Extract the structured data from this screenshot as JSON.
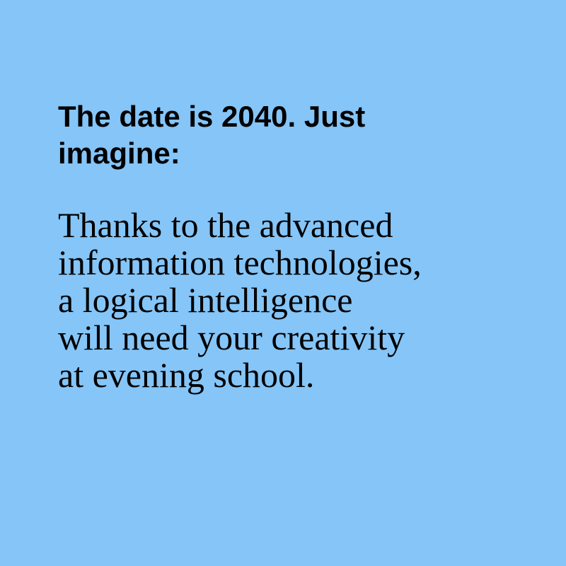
{
  "slide": {
    "background_color": "#85c5f8",
    "text_color": "#000000",
    "headline_lines": [
      "The date is 2040. Just",
      "imagine:"
    ],
    "body_lines": [
      "Thanks to the advanced",
      "information technologies,",
      "a logical intelligence",
      "will need your creativity",
      "at evening school."
    ]
  }
}
